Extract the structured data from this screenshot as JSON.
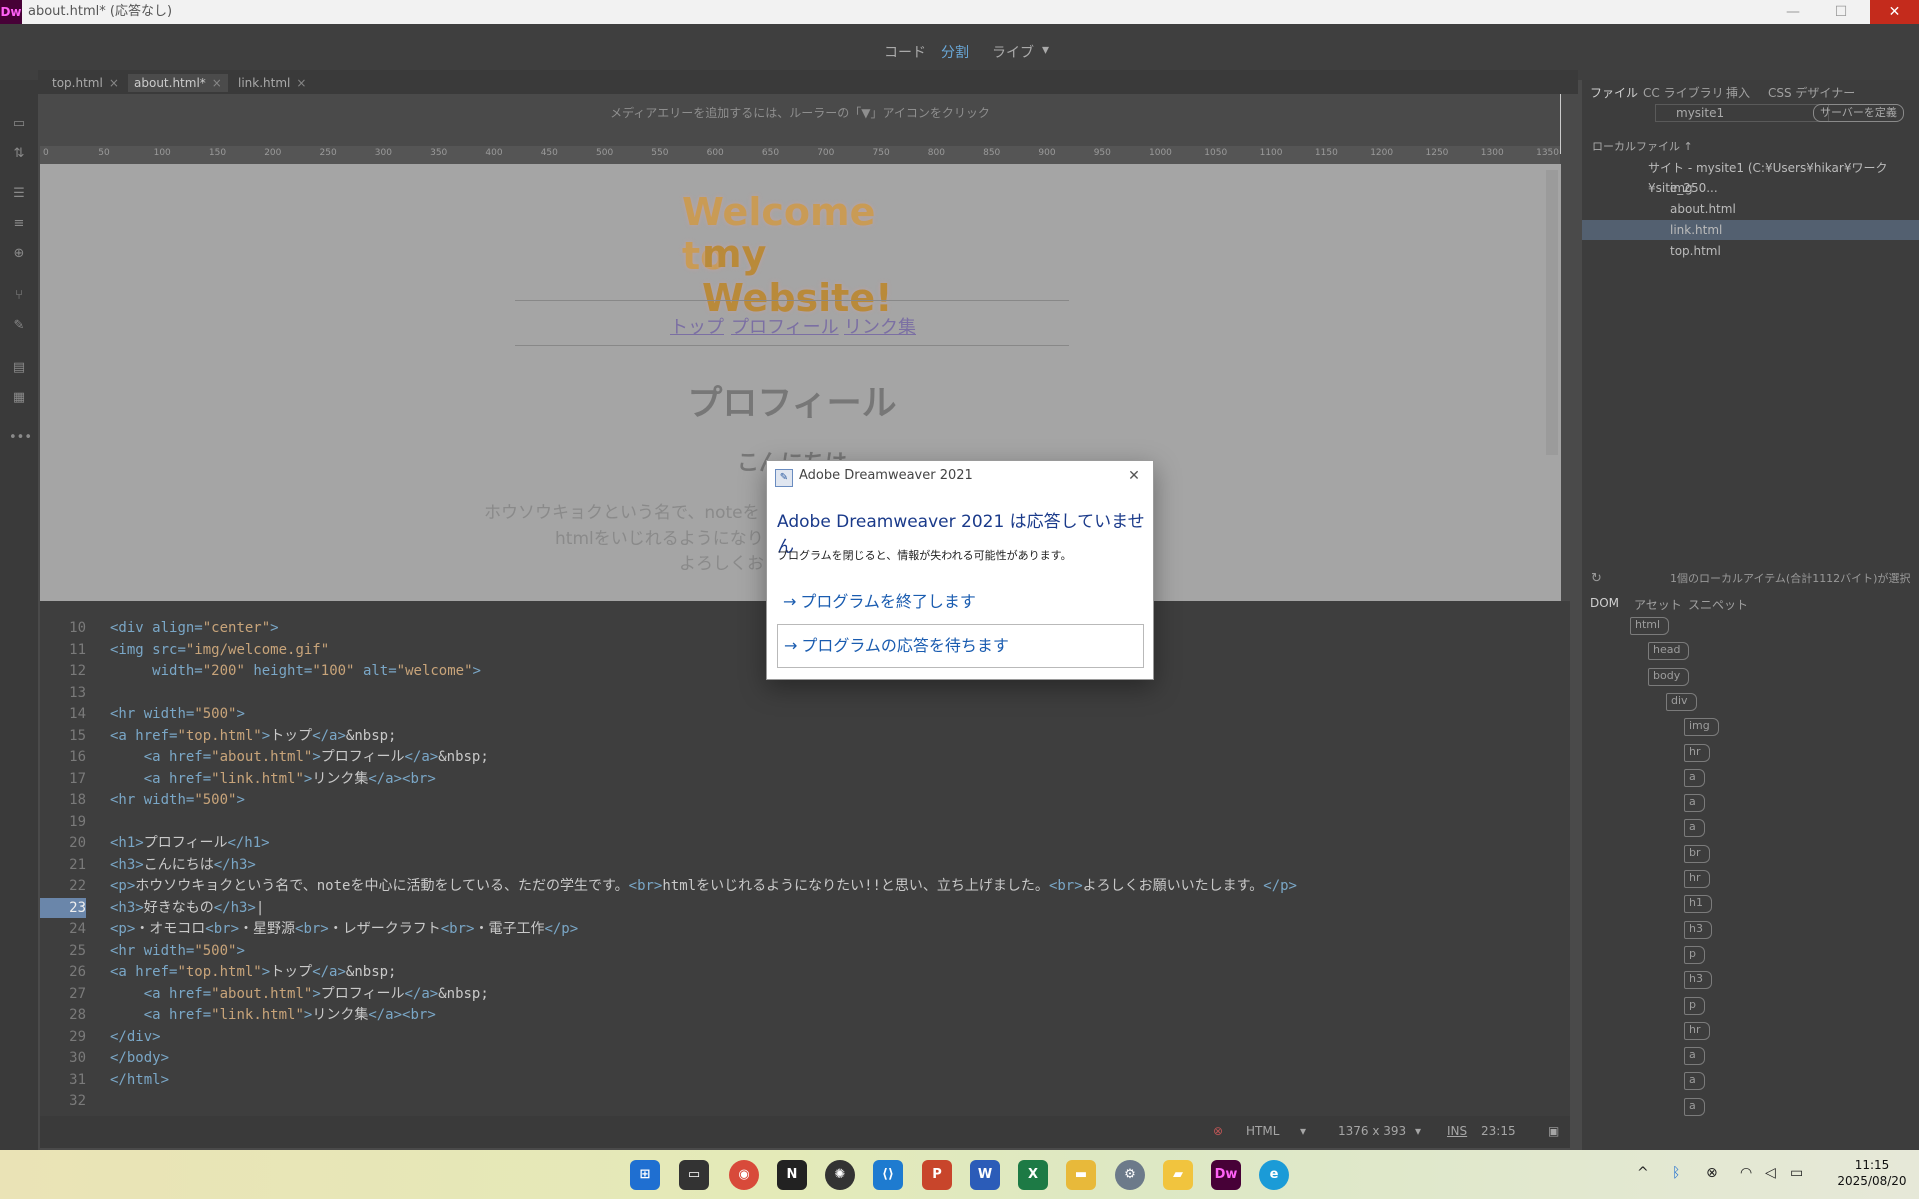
{
  "window": {
    "title": "about.html* (応答なし)",
    "app_logo": "Dw",
    "minimize": "—",
    "maximize": "☐",
    "close": "✕"
  },
  "viewbar": {
    "code": "コード",
    "split": "分割",
    "live": "ライブ",
    "dropdown": "▾"
  },
  "tabs": [
    {
      "label": "top.html"
    },
    {
      "label": "about.html*"
    },
    {
      "label": "link.html"
    }
  ],
  "tab_close": "×",
  "media_query_hint": "メディアエリーを追加するには、ルーラーの「▼」アイコンをクリック",
  "ruler": [
    "0",
    "50",
    "100",
    "150",
    "200",
    "250",
    "300",
    "350",
    "400",
    "450",
    "500",
    "550",
    "600",
    "650",
    "700",
    "750",
    "800",
    "850",
    "900",
    "950",
    "1000",
    "1050",
    "1100",
    "1150",
    "1200",
    "1250",
    "1300",
    "1350"
  ],
  "live": {
    "welcome_line1": "Welcome to",
    "welcome_line2": "my Website!",
    "nav": [
      "トップ",
      "プロフィール",
      "リンク集"
    ],
    "h1": "プロフィール",
    "h3": "こんにちは",
    "p_line1": "ホウソウキョクという名で、noteを",
    "p_line2": "htmlをいじれるようになり",
    "p_line3": "よろしくお"
  },
  "code_lines": [
    {
      "n": "10",
      "html": "<span class=\"tag\">&lt;div</span> <span class=\"tag\">align=</span><span class=\"str\">\"center\"</span><span class=\"tag\">&gt;</span>"
    },
    {
      "n": "11",
      "html": "<span class=\"tag\">&lt;img</span> <span class=\"tag\">src=</span><span class=\"str\">\"img/welcome.gif\"</span>"
    },
    {
      "n": "12",
      "html": "     <span class=\"tag\">width=</span><span class=\"str\">\"200\"</span> <span class=\"tag\">height=</span><span class=\"str\">\"100\"</span> <span class=\"tag\">alt=</span><span class=\"str\">\"welcome\"</span><span class=\"tag\">&gt;</span>"
    },
    {
      "n": "13",
      "html": ""
    },
    {
      "n": "14",
      "html": "<span class=\"tag\">&lt;hr</span> <span class=\"tag\">width=</span><span class=\"str\">\"500\"</span><span class=\"tag\">&gt;</span>"
    },
    {
      "n": "15",
      "html": "<span class=\"tag\">&lt;a</span> <span class=\"tag\">href=</span><span class=\"str\">\"top.html\"</span><span class=\"tag\">&gt;</span>トップ<span class=\"tag\">&lt;/a&gt;</span>&amp;nbsp;"
    },
    {
      "n": "16",
      "html": "    <span class=\"tag\">&lt;a</span> <span class=\"tag\">href=</span><span class=\"str\">\"about.html\"</span><span class=\"tag\">&gt;</span>プロフィール<span class=\"tag\">&lt;/a&gt;</span>&amp;nbsp;"
    },
    {
      "n": "17",
      "html": "    <span class=\"tag\">&lt;a</span> <span class=\"tag\">href=</span><span class=\"str\">\"link.html\"</span><span class=\"tag\">&gt;</span>リンク集<span class=\"tag\">&lt;/a&gt;&lt;br&gt;</span>"
    },
    {
      "n": "18",
      "html": "<span class=\"tag\">&lt;hr</span> <span class=\"tag\">width=</span><span class=\"str\">\"500\"</span><span class=\"tag\">&gt;</span>"
    },
    {
      "n": "19",
      "html": ""
    },
    {
      "n": "20",
      "html": "<span class=\"tag\">&lt;h1&gt;</span>プロフィール<span class=\"tag\">&lt;/h1&gt;</span>"
    },
    {
      "n": "21",
      "html": "<span class=\"tag\">&lt;h3&gt;</span>こんにちは<span class=\"tag\">&lt;/h3&gt;</span>"
    },
    {
      "n": "22",
      "html": "<span class=\"tag\">&lt;p&gt;</span>ホウソウキョクという名で、noteを中心に活動をしている、ただの学生です。<span class=\"tag\">&lt;br&gt;</span>htmlをいじれるようになりたい!!と思い、立ち上げました。<span class=\"tag\">&lt;br&gt;</span>よろしくお願いいたします。<span class=\"tag\">&lt;/p&gt;</span>"
    },
    {
      "n": "23",
      "html": "<span class=\"tag\">&lt;h3&gt;</span>好きなもの<span class=\"tag\">&lt;/h3&gt;</span>|"
    },
    {
      "n": "24",
      "html": "<span class=\"tag\">&lt;p&gt;</span>・オモコロ<span class=\"tag\">&lt;br&gt;</span>・星野源<span class=\"tag\">&lt;br&gt;</span>・レザークラフト<span class=\"tag\">&lt;br&gt;</span>・電子工作<span class=\"tag\">&lt;/p&gt;</span>"
    },
    {
      "n": "25",
      "html": "<span class=\"tag\">&lt;hr</span> <span class=\"tag\">width=</span><span class=\"str\">\"500\"</span><span class=\"tag\">&gt;</span>"
    },
    {
      "n": "26",
      "html": "<span class=\"tag\">&lt;a</span> <span class=\"tag\">href=</span><span class=\"str\">\"top.html\"</span><span class=\"tag\">&gt;</span>トップ<span class=\"tag\">&lt;/a&gt;</span>&amp;nbsp;"
    },
    {
      "n": "27",
      "html": "    <span class=\"tag\">&lt;a</span> <span class=\"tag\">href=</span><span class=\"str\">\"about.html\"</span><span class=\"tag\">&gt;</span>プロフィール<span class=\"tag\">&lt;/a&gt;</span>&amp;nbsp;"
    },
    {
      "n": "28",
      "html": "    <span class=\"tag\">&lt;a</span> <span class=\"tag\">href=</span><span class=\"str\">\"link.html\"</span><span class=\"tag\">&gt;</span>リンク集<span class=\"tag\">&lt;/a&gt;&lt;br&gt;</span>"
    },
    {
      "n": "29",
      "html": "<span class=\"tag\">&lt;/div&gt;</span>"
    },
    {
      "n": "30",
      "html": "<span class=\"tag\">&lt;/body&gt;</span>"
    },
    {
      "n": "31",
      "html": "<span class=\"tag\">&lt;/html&gt;</span>"
    },
    {
      "n": "32",
      "html": ""
    }
  ],
  "current_line": "23",
  "status": {
    "language": "HTML",
    "size": "1376 x 393",
    "mode": "INS",
    "position": "23:15"
  },
  "right_panel": {
    "tabs": [
      "ファイル",
      "CC ライブラリ",
      "挿入",
      "CSS デザイナー"
    ],
    "site_select": "mysite1",
    "define_server": "サーバーを定義",
    "local_files_label": "ローカルファイル ↑",
    "site_root": "サイト - mysite1 (C:¥Users¥hikar¥ワーク¥site_250...",
    "files": [
      "img",
      "about.html",
      "link.html",
      "top.html"
    ],
    "status_text": "1個のローカルアイテム(合計1112バイト)が選択さ...",
    "lower_tabs": [
      "DOM",
      "アセット",
      "スニペット"
    ],
    "dom_nodes": [
      "html",
      "head",
      "body",
      "div",
      "img",
      "hr",
      "a",
      "a",
      "a",
      "br",
      "hr",
      "h1",
      "h3",
      "p",
      "h3",
      "p",
      "hr",
      "a",
      "a",
      "a"
    ]
  },
  "dialog": {
    "title": "Adobe Dreamweaver 2021",
    "close": "✕",
    "heading": "Adobe Dreamweaver 2021 は応答していません",
    "message": "プログラムを閉じると、情報が失われる可能性があります。",
    "option_close": "プログラムを終了します",
    "option_wait": "プログラムの応答を待ちます",
    "arrow": "→"
  },
  "taskbar": {
    "time": "11:15",
    "date": "2025/08/20",
    "icons": [
      "windows-start-icon",
      "task-view-icon",
      "chrome-icon",
      "notion-icon",
      "chatgpt-icon",
      "vscode-icon",
      "powerpoint-icon",
      "word-icon",
      "excel-icon",
      "file-explorer-icon",
      "settings-icon",
      "sticky-notes-icon",
      "dreamweaver-icon",
      "edge-icon"
    ]
  },
  "colors": {
    "accent": "#1a5cb0",
    "dw_brand": "#470137",
    "selection": "#536070"
  }
}
